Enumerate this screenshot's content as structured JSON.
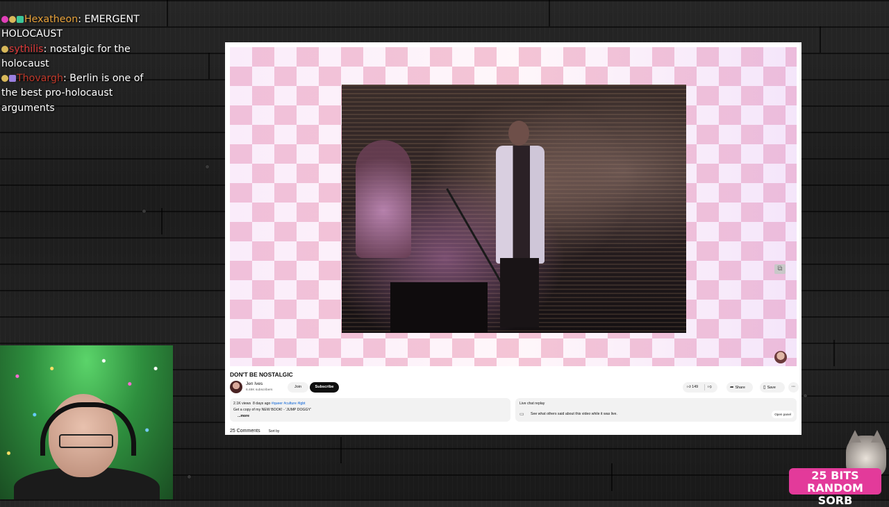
{
  "chat": {
    "messages": [
      {
        "badges": [
          "#e040b8",
          "#d8b85a",
          "#3cc79a"
        ],
        "user": "Hexatheon",
        "user_color": "#e8a23a",
        "text": ": EMERGENT HOLOCAUST"
      },
      {
        "badges": [
          "#d8b85a"
        ],
        "user": "sythilis",
        "user_color": "#e03b3b",
        "text": ": nostalgic for the holocaust"
      },
      {
        "badges": [
          "#d8b85a",
          "#9a7fe0"
        ],
        "user": "Thovargh",
        "user_color": "#c0392b",
        "text": ": Berlin is one of the best pro-holocaust arguments"
      }
    ]
  },
  "youtube": {
    "title": "DON'T BE NOSTALGIC",
    "channel_name": "Jen Ives",
    "channel_subs": "6.48K subscribers",
    "join_label": "Join",
    "subscribe_label": "Subscribe",
    "likes": "149",
    "share_label": "Share",
    "save_label": "Save",
    "more_label": "···",
    "views": "2.1K views",
    "age": "8 days ago",
    "tags": "#queer #culture #lgbt",
    "desc_line": "Get a copy of my NEW BOOK! - 'JUMP DOGGY'",
    "desc_more": "...more",
    "chat_replay_heading": "Live chat replay",
    "chat_replay_text": "See what others said about this video while it was live.",
    "open_panel_label": "Open panel",
    "comments_label": "25 Comments",
    "sort_label": "Sort by"
  },
  "goal": {
    "line1": "25 BITS",
    "line2": "RANDOM SORB"
  },
  "colors": {
    "subscribe_bg": "#0f0f0f",
    "goal_bg": "#e33a9a",
    "link": "#065fd4"
  }
}
